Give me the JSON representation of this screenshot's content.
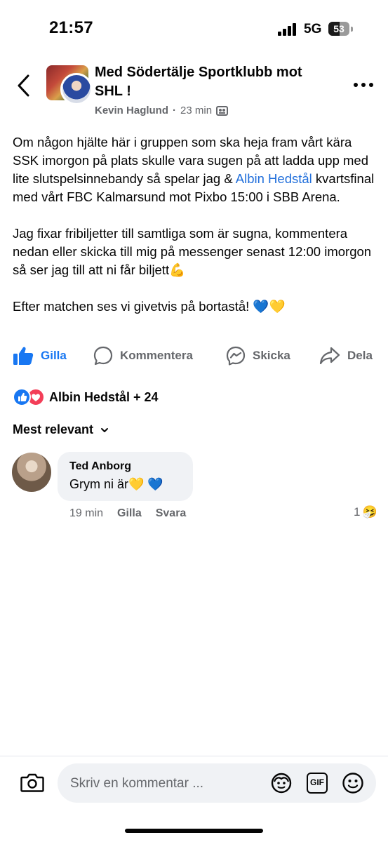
{
  "status_bar": {
    "time": "21:57",
    "network": "5G",
    "battery": "53",
    "battery_fraction": 0.53
  },
  "header": {
    "title": "Med Södertälje Sportklubb mot SHL !",
    "author": "Kevin Haglund",
    "separator": "·",
    "time_ago": "23 min",
    "icons": {
      "back": "back-chevron-icon",
      "more": "more-icon",
      "audience": "group-audience-icon"
    }
  },
  "post": {
    "p1_before": "Om någon hjälte här i gruppen som ska heja fram vårt kära SSK imorgon på plats skulle vara sugen på att ladda upp med lite slutspelsinnebandy så spelar jag & ",
    "p1_mention": "Albin Hedstål",
    "p1_after": " kvartsfinal med vårt FBC Kalmarsund mot Pixbo 15:00 i SBB Arena.",
    "p2": "Jag fixar fribiljetter till samtliga som är sugna, kommentera nedan eller skicka till mig på messenger senast 12:00 imorgon så ser jag till att ni får biljett💪",
    "p3": "Efter matchen ses vi givetvis på bortastå! 💙💛"
  },
  "actions": {
    "like": "Gilla",
    "comment": "Kommentera",
    "send": "Skicka",
    "share": "Dela"
  },
  "reactions": {
    "summary": "Albin Hedstål + 24"
  },
  "comments_sort": {
    "label": "Mest relevant"
  },
  "comment": {
    "name": "Ted Anborg",
    "text": "Grym ni är💛 💙",
    "time": "19 min",
    "like": "Gilla",
    "reply": "Svara",
    "reaction_count": "1",
    "reaction_emoji": "🤧"
  },
  "composer": {
    "placeholder": "Skriv en kommentar ...",
    "gif": "GIF"
  },
  "colors": {
    "accent": "#1877f2",
    "secondary_text": "#65676b",
    "bubble": "#f0f2f5",
    "love": "#f33e58"
  }
}
